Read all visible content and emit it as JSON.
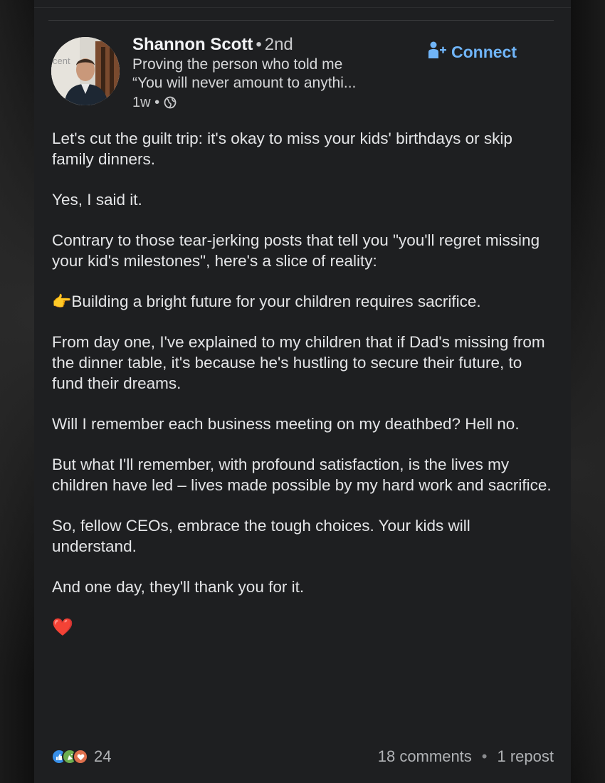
{
  "author": {
    "name": "Shannon Scott",
    "separator": "•",
    "degree": "2nd",
    "headline_line1": "Proving the person who told me",
    "headline_line2": "“You will never amount to anythi...",
    "time": "1w •",
    "avatar_sign_text": "cent"
  },
  "connect": {
    "label": "Connect"
  },
  "post": {
    "paragraphs": [
      "Let's cut the guilt trip: it's okay to miss your kids' birthdays or skip family dinners.",
      "Yes, I said it.",
      "Contrary to those tear-jerking posts that tell you \"you'll regret missing your kid's milestones\", here's a slice of reality:",
      "Building a bright future for your children requires sacrifice.",
      "From day one, I've explained to my children that if Dad's missing from the dinner table, it's because he's hustling to secure their future, to fund their dreams.",
      "Will I remember each business meeting on my deathbed? Hell no.",
      "But what I'll remember, with profound satisfaction, is the lives my children have led – lives made possible by my hard work and sacrifice.",
      "So, fellow CEOs, embrace the tough choices. Your kids will understand.",
      "And one day, they'll thank you for it."
    ],
    "bullet_emoji": "👉",
    "closing_emoji": "❤️"
  },
  "footer": {
    "reaction_count": "24",
    "comments": "18 comments",
    "separator": "•",
    "reposts": "1 repost"
  },
  "colors": {
    "card_bg": "#1e1f21",
    "accent": "#70b5f9",
    "text": "#e4e5e7"
  }
}
